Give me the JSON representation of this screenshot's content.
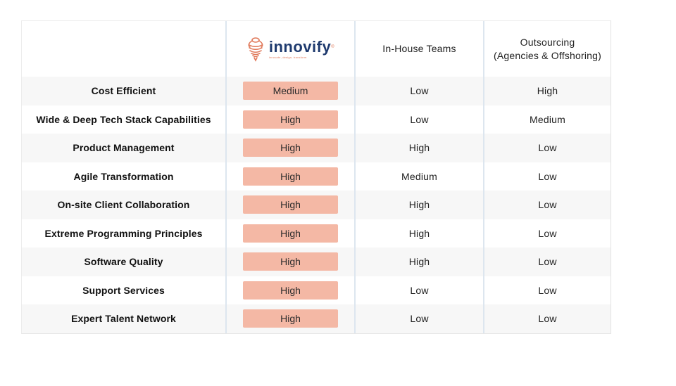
{
  "header": {
    "col0": "",
    "col1_logo": {
      "brand": "innovify",
      "registered_mark": "®",
      "tagline": "innovate, design, transform",
      "icon": "spinning-top-logo-icon"
    },
    "col2": "In-House Teams",
    "col3_line1": "Outsourcing",
    "col3_line2": "(Agencies & Offshoring)"
  },
  "colors": {
    "highlight": "#f4b8a5",
    "brand_navy": "#1e3a6e",
    "brand_orange": "#e0795a",
    "row_alt": "#f7f7f7",
    "divider": "#dde6ef"
  },
  "rows": [
    {
      "criterion": "Cost Efficient",
      "innovify": "Medium",
      "inhouse": "Low",
      "outsourcing": "High"
    },
    {
      "criterion": "Wide & Deep Tech Stack Capabilities",
      "innovify": "High",
      "inhouse": "Low",
      "outsourcing": "Medium"
    },
    {
      "criterion": "Product Management",
      "innovify": "High",
      "inhouse": "High",
      "outsourcing": "Low"
    },
    {
      "criterion": "Agile Transformation",
      "innovify": "High",
      "inhouse": "Medium",
      "outsourcing": "Low"
    },
    {
      "criterion": "On-site Client Collaboration",
      "innovify": "High",
      "inhouse": "High",
      "outsourcing": "Low"
    },
    {
      "criterion": "Extreme Programming Principles",
      "innovify": "High",
      "inhouse": "High",
      "outsourcing": "Low"
    },
    {
      "criterion": "Software Quality",
      "innovify": "High",
      "inhouse": "High",
      "outsourcing": "Low"
    },
    {
      "criterion": "Support Services",
      "innovify": "High",
      "inhouse": "Low",
      "outsourcing": "Low"
    },
    {
      "criterion": "Expert Talent Network",
      "innovify": "High",
      "inhouse": "Low",
      "outsourcing": "Low"
    }
  ]
}
